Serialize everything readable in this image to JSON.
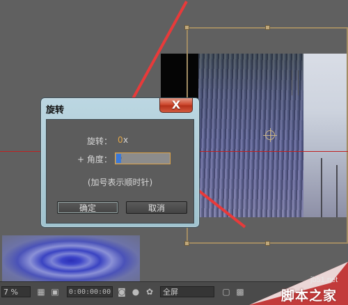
{
  "dialog": {
    "title": "旋转",
    "close_label": "X",
    "rotation_label": "旋转：",
    "rotation_value": "0",
    "rotation_unit": "x",
    "angle_label": "+ 角度：",
    "angle_value": "0",
    "hint": "(加号表示顺时针)",
    "ok_label": "确定",
    "cancel_label": "取消"
  },
  "toolbar": {
    "zoom": "7 %",
    "timecode": "0:00:00:00",
    "resolution": "全屏"
  },
  "watermark": {
    "site": "jb51.net",
    "brand": "脚本之家"
  },
  "colors": {
    "guide": "#c02020",
    "arrow": "#e83a3a",
    "accent_value": "#e0a64a",
    "bbox": "#a28c63"
  }
}
